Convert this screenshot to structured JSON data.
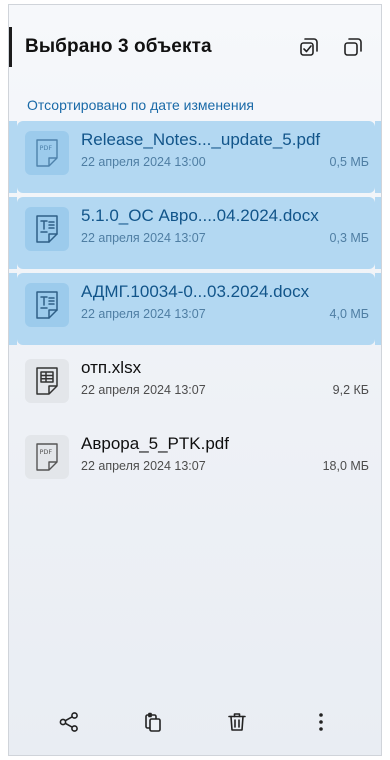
{
  "header": {
    "title": "Выбрано 3 объекта",
    "actions": [
      {
        "icon": "select-all-icon"
      },
      {
        "icon": "deselect-icon"
      }
    ]
  },
  "sort": {
    "label": "Отсортировано по дате изменения"
  },
  "files": [
    {
      "name": "Release_Notes..._update_5.pdf",
      "date": "22 апреля 2024 13:00",
      "size": "0,5 МБ",
      "type": "pdf",
      "icon": "pdf-file-icon",
      "selected": true
    },
    {
      "name": "5.1.0_ОС Авро....04.2024.docx",
      "date": "22 апреля 2024 13:07",
      "size": "0,3 МБ",
      "type": "docx",
      "icon": "document-file-icon",
      "selected": true
    },
    {
      "name": "АДМГ.10034-0...03.2024.docx",
      "date": "22 апреля 2024 13:07",
      "size": "4,0 МБ",
      "type": "docx",
      "icon": "document-file-icon",
      "selected": true
    },
    {
      "name": "отп.xlsx",
      "date": "22 апреля 2024 13:07",
      "size": "9,2 КБ",
      "type": "xlsx",
      "icon": "spreadsheet-file-icon",
      "selected": false
    },
    {
      "name": "Аврора_5_PTK.pdf",
      "date": "22 апреля 2024 13:07",
      "size": "18,0 МБ",
      "type": "pdf",
      "icon": "pdf-file-icon",
      "selected": false
    }
  ],
  "bottom_bar": [
    {
      "icon": "share-icon"
    },
    {
      "icon": "copy-icon"
    },
    {
      "icon": "trash-icon"
    },
    {
      "icon": "more-vertical-icon"
    }
  ],
  "colors": {
    "selected_row": "#b3d8f2",
    "accent_text": "#1a6aa8"
  }
}
